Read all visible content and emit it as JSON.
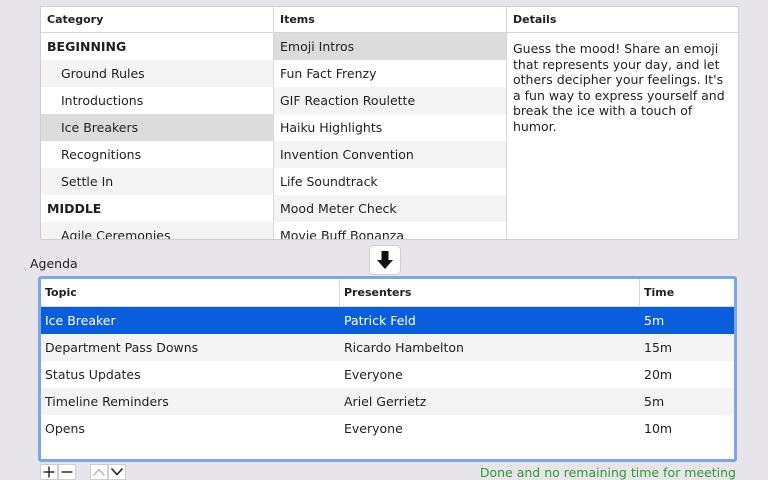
{
  "browser": {
    "columns": [
      "Category",
      "Items",
      "Details"
    ],
    "categories": [
      {
        "label": "BEGINNING"
      },
      {
        "label": "Ground Rules"
      },
      {
        "label": "Introductions"
      },
      {
        "label": "Ice Breakers"
      },
      {
        "label": "Recognitions"
      },
      {
        "label": "Settle In"
      },
      {
        "label": "MIDDLE"
      },
      {
        "label": "Agile Ceremonies"
      }
    ],
    "items": [
      {
        "label": "Emoji Intros"
      },
      {
        "label": "Fun Fact Frenzy"
      },
      {
        "label": "GIF Reaction Roulette"
      },
      {
        "label": "Haiku Highlights"
      },
      {
        "label": "Invention Convention"
      },
      {
        "label": "Life Soundtrack"
      },
      {
        "label": "Mood Meter Check"
      },
      {
        "label": "Movie Buff Bonanza"
      }
    ],
    "details": "Guess the mood! Share an emoji that represents your day, and let others decipher your feelings. It's a fun way to express yourself and break the ice with a touch of humor."
  },
  "agenda": {
    "label": "Agenda",
    "columns": [
      "Topic",
      "Presenters",
      "Time"
    ],
    "rows": [
      {
        "topic": "Ice Breaker",
        "presenter": "Patrick Feld",
        "time": "5m"
      },
      {
        "topic": "Department Pass Downs",
        "presenter": "Ricardo Hambelton",
        "time": "15m"
      },
      {
        "topic": "Status Updates",
        "presenter": "Everyone",
        "time": "20m"
      },
      {
        "topic": "Timeline Reminders",
        "presenter": "Ariel Gerrietz",
        "time": "5m"
      },
      {
        "topic": "Opens",
        "presenter": "Everyone",
        "time": "10m"
      }
    ]
  },
  "status": "Done and no remaining time for meeting",
  "icons": {
    "add": "plus-icon",
    "remove": "minus-icon",
    "move_up": "chevron-up-icon",
    "move_down": "chevron-down-icon",
    "insert": "arrow-down-icon"
  },
  "colors": {
    "selection": "#0a5ddb",
    "focus_ring": "#7ea6e6",
    "status": "#2f9a2f"
  }
}
